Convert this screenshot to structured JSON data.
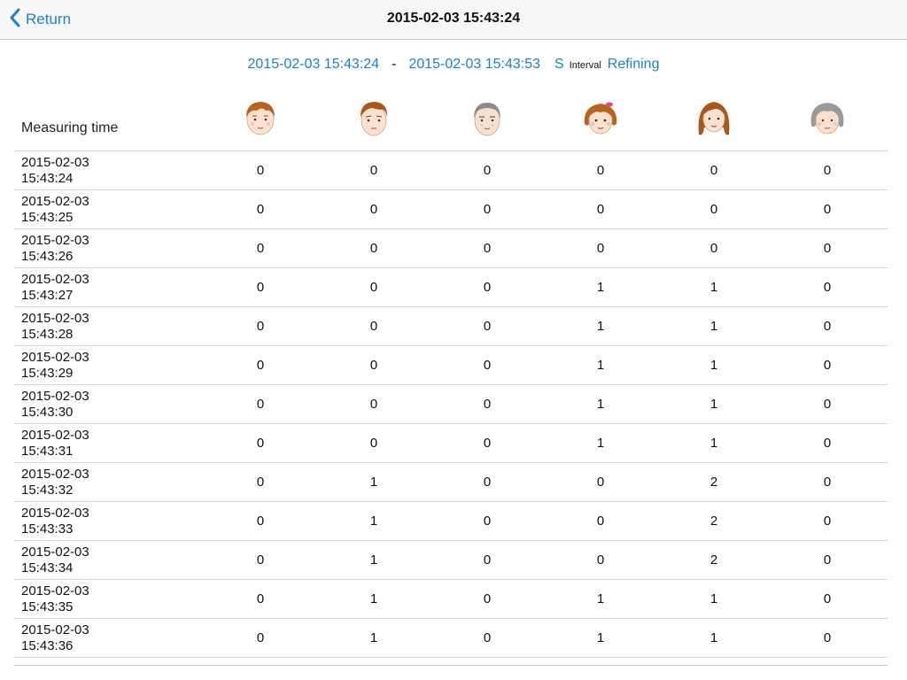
{
  "nav": {
    "back_label": "Return",
    "title": "2015-02-03 15:43:24"
  },
  "range": {
    "start": "2015-02-03 15:43:24",
    "separator": "-",
    "end": "2015-02-03 15:43:53",
    "unit": "S",
    "interval_label": "Interval",
    "refine_label": "Refining"
  },
  "table": {
    "time_header": "Measuring time",
    "columns": [
      {
        "icon": "young-man-face-icon"
      },
      {
        "icon": "man-face-icon"
      },
      {
        "icon": "elderly-man-face-icon"
      },
      {
        "icon": "young-woman-face-icon"
      },
      {
        "icon": "woman-face-icon"
      },
      {
        "icon": "elderly-woman-face-icon"
      }
    ],
    "rows": [
      {
        "date": "2015-02-03",
        "time": "15:43:24",
        "values": [
          0,
          0,
          0,
          0,
          0,
          0
        ]
      },
      {
        "date": "2015-02-03",
        "time": "15:43:25",
        "values": [
          0,
          0,
          0,
          0,
          0,
          0
        ]
      },
      {
        "date": "2015-02-03",
        "time": "15:43:26",
        "values": [
          0,
          0,
          0,
          0,
          0,
          0
        ]
      },
      {
        "date": "2015-02-03",
        "time": "15:43:27",
        "values": [
          0,
          0,
          0,
          1,
          1,
          0
        ]
      },
      {
        "date": "2015-02-03",
        "time": "15:43:28",
        "values": [
          0,
          0,
          0,
          1,
          1,
          0
        ]
      },
      {
        "date": "2015-02-03",
        "time": "15:43:29",
        "values": [
          0,
          0,
          0,
          1,
          1,
          0
        ]
      },
      {
        "date": "2015-02-03",
        "time": "15:43:30",
        "values": [
          0,
          0,
          0,
          1,
          1,
          0
        ]
      },
      {
        "date": "2015-02-03",
        "time": "15:43:31",
        "values": [
          0,
          0,
          0,
          1,
          1,
          0
        ]
      },
      {
        "date": "2015-02-03",
        "time": "15:43:32",
        "values": [
          0,
          1,
          0,
          0,
          2,
          0
        ]
      },
      {
        "date": "2015-02-03",
        "time": "15:43:33",
        "values": [
          0,
          1,
          0,
          0,
          2,
          0
        ]
      },
      {
        "date": "2015-02-03",
        "time": "15:43:34",
        "values": [
          0,
          1,
          0,
          0,
          2,
          0
        ]
      },
      {
        "date": "2015-02-03",
        "time": "15:43:35",
        "values": [
          0,
          1,
          0,
          1,
          1,
          0
        ]
      },
      {
        "date": "2015-02-03",
        "time": "15:43:36",
        "values": [
          0,
          1,
          0,
          1,
          1,
          0
        ]
      }
    ]
  },
  "colors": {
    "accent": "#1a7fd6",
    "divider": "#d6d6d6",
    "navbar_bg": "#f7f7f7"
  }
}
